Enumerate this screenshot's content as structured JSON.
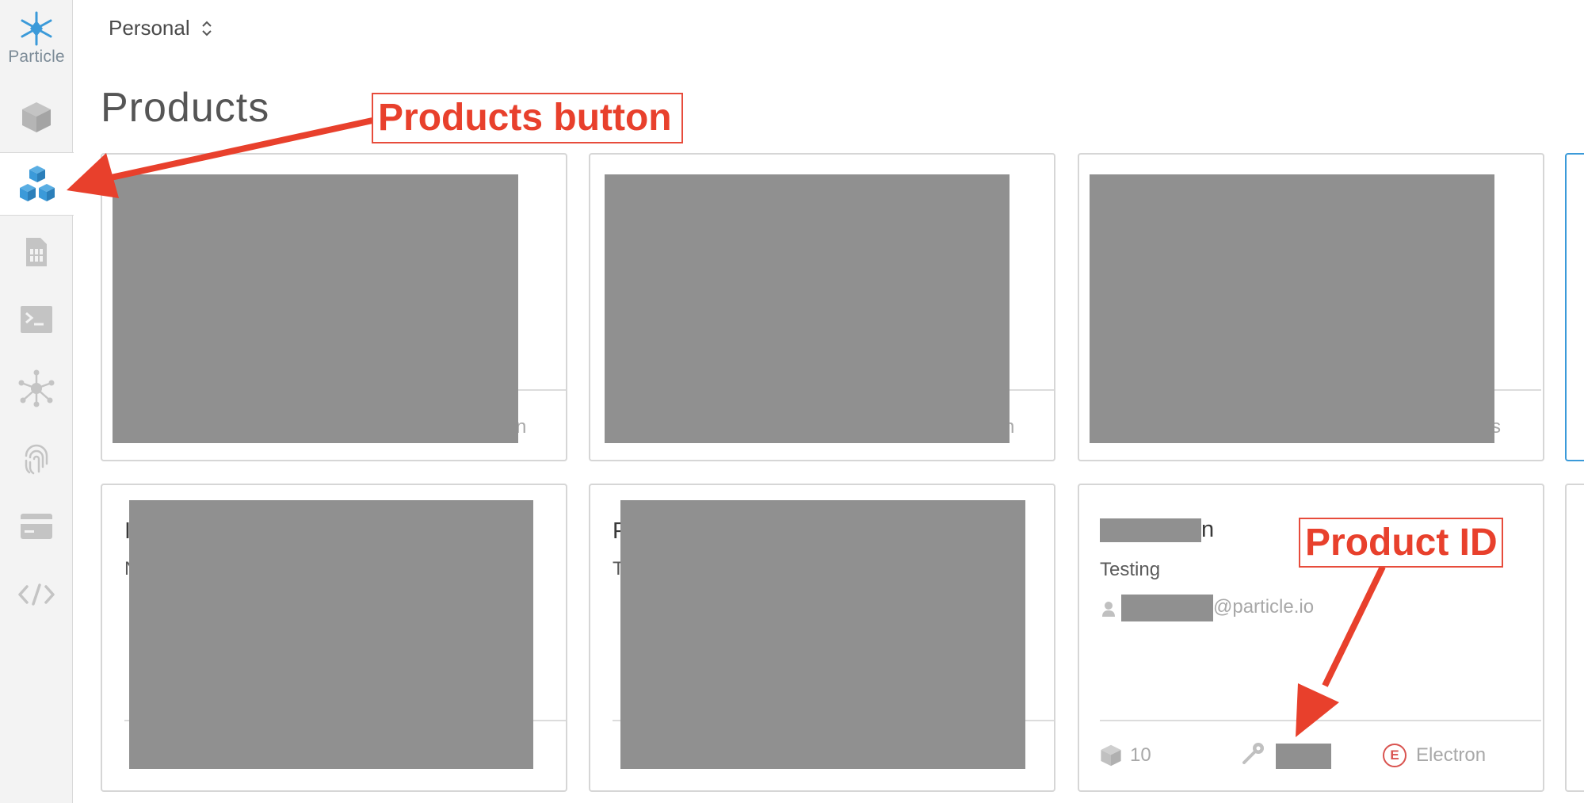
{
  "brand": {
    "name": "Particle"
  },
  "org_switcher": {
    "label": "Personal"
  },
  "page": {
    "title": "Products"
  },
  "sidebar": {
    "items": [
      {
        "name": "devices",
        "icon": "cube-icon"
      },
      {
        "name": "products",
        "icon": "cubes-icon",
        "active": true
      },
      {
        "name": "sim-cards",
        "icon": "sim-card-icon"
      },
      {
        "name": "console",
        "icon": "terminal-icon"
      },
      {
        "name": "integrations",
        "icon": "network-icon"
      },
      {
        "name": "authentication",
        "icon": "fingerprint-icon"
      },
      {
        "name": "billing",
        "icon": "credit-card-icon"
      },
      {
        "name": "developer",
        "icon": "code-icon"
      }
    ]
  },
  "cards": {
    "c1": {
      "peek": "n"
    },
    "c2": {
      "peek": "n"
    },
    "c3": {
      "peek": "s"
    },
    "c4": {
      "peek_name": "I",
      "peek_type": "N"
    },
    "c5": {
      "peek_name": "P",
      "peek_type": "T"
    },
    "c6": {
      "name_suffix": "n",
      "type": "Testing",
      "owner_suffix": "@particle.io",
      "device_count": "10",
      "platform_badge": "E",
      "platform": "Electron"
    }
  },
  "annotations": {
    "products_button": "Products button",
    "product_id": "Product ID"
  },
  "colors": {
    "accent_blue": "#3b9ad9",
    "annotation_red": "#e8402c",
    "redaction_gray": "#909090"
  }
}
